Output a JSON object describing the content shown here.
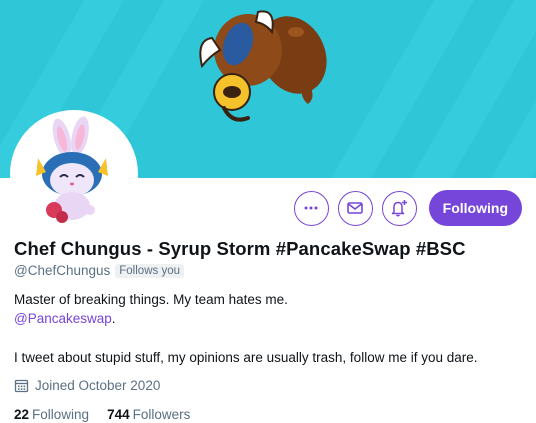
{
  "banner": {
    "background_color": "#2fc6d7",
    "mascot_icon": "bull-mascot-icon"
  },
  "avatar": {
    "icon": "bunny-chef-avatar-icon"
  },
  "actions": {
    "more_icon": "more-icon",
    "message_icon": "envelope-icon",
    "notify_icon": "bell-add-icon",
    "following_label": "Following",
    "accent_color": "#7645d9"
  },
  "profile": {
    "display_name": "Chef Chungus - Syrup Storm #PancakeSwap #BSC",
    "handle": "@ChefChungus",
    "follows_you_badge": "Follows you",
    "bio_line1": "Master of breaking things. My team hates me.",
    "bio_mention": "@Pancakeswap",
    "bio_mention_suffix": ".",
    "bio_line2": "I tweet about stupid stuff, my opinions are usually trash, follow me if you dare.",
    "joined_icon": "calendar-icon",
    "joined_text": "Joined October 2020",
    "following_count": "22",
    "following_label": "Following",
    "followers_count": "744",
    "followers_label": "Followers"
  }
}
